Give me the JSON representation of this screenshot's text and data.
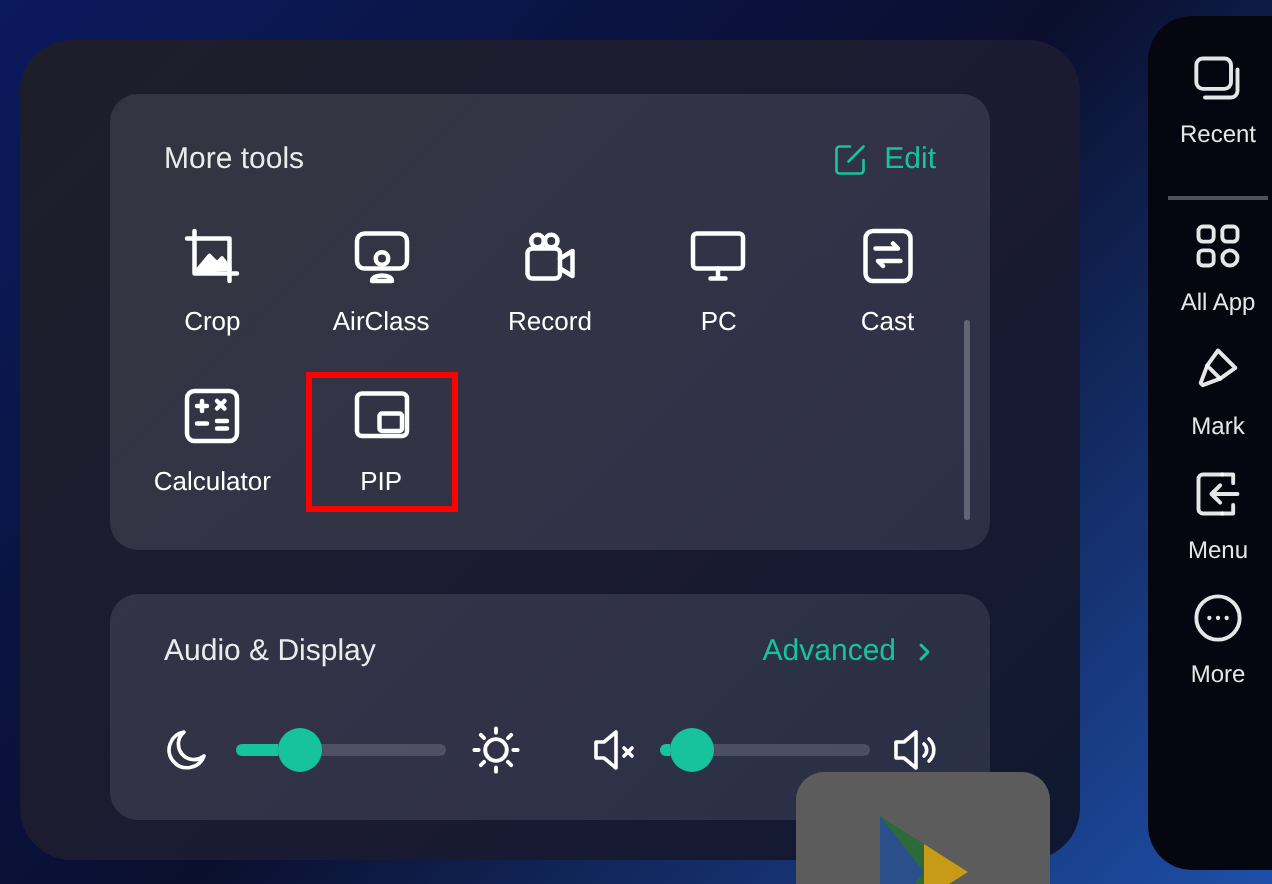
{
  "more_tools": {
    "title": "More tools",
    "edit_label": "Edit",
    "tools": [
      {
        "label": "Crop",
        "kind": "crop",
        "highlighted": false
      },
      {
        "label": "AirClass",
        "kind": "airclass",
        "highlighted": false
      },
      {
        "label": "Record",
        "kind": "record",
        "highlighted": false
      },
      {
        "label": "PC",
        "kind": "pc",
        "highlighted": false
      },
      {
        "label": "Cast",
        "kind": "cast",
        "highlighted": false
      },
      {
        "label": "Calculator",
        "kind": "calculator",
        "highlighted": false
      },
      {
        "label": "PIP",
        "kind": "pip",
        "highlighted": true
      }
    ]
  },
  "audio_display": {
    "title": "Audio & Display",
    "advanced_label": "Advanced",
    "sliders": [
      {
        "kind": "brightness",
        "level": 0.3
      },
      {
        "kind": "volume",
        "level": 0.15
      }
    ]
  },
  "sidebar": {
    "items": [
      {
        "label": "Recent",
        "kind": "recents"
      },
      {
        "label": "All App",
        "kind": "apps"
      },
      {
        "label": "Mark",
        "kind": "mark"
      },
      {
        "label": "Menu",
        "kind": "menu"
      },
      {
        "label": "More",
        "kind": "more"
      }
    ]
  }
}
